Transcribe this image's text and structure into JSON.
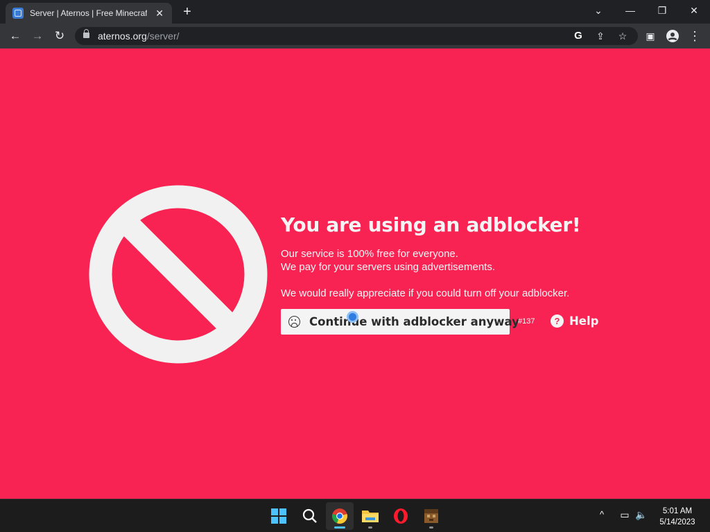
{
  "browser": {
    "tab": {
      "title": "Server | Aternos | Free Minecraft",
      "close_glyph": "✕"
    },
    "new_tab_glyph": "+",
    "window_controls": {
      "dropdown": "⌄",
      "minimize": "—",
      "restore": "❐",
      "close": "✕"
    },
    "nav": {
      "back": "←",
      "forward": "→",
      "reload": "↻"
    },
    "address": {
      "host": "aternos.org",
      "path": "/server/"
    },
    "omnibox_icons": {
      "google": "G",
      "share": "⇪",
      "bookmark": "☆"
    },
    "toolbar_icons": {
      "side_panel": "▣",
      "profile": "●",
      "menu": "⋮"
    }
  },
  "page": {
    "background_color": "#f82352",
    "headline": "You are using an adblocker!",
    "line1": "Our service is 100% free for everyone.",
    "line2": "We pay for your servers using advertisements.",
    "line3": "We would really appreciate if you could turn off your adblocker.",
    "continue_button": "Continue with adblocker anyway",
    "issue_number": "#137",
    "help_icon_glyph": "?",
    "help_label": "Help"
  },
  "taskbar": {
    "apps": [
      "start",
      "search",
      "chrome",
      "file-explorer",
      "opera",
      "minecraft"
    ],
    "active_app": "chrome",
    "tray": {
      "chevron": "^",
      "network": "▭",
      "volume": "🔈"
    },
    "time": "5:01 AM",
    "date": "5/14/2023"
  }
}
